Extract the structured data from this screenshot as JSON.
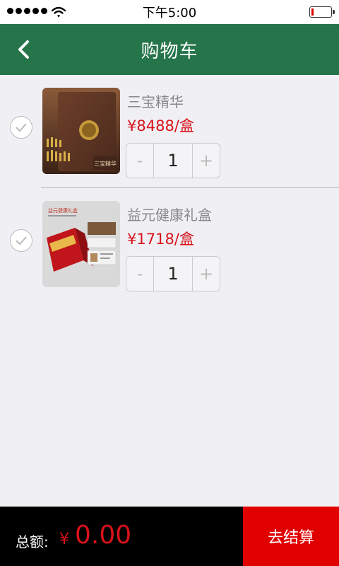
{
  "status_bar": {
    "time": "下午5:00"
  },
  "nav": {
    "title": "购物车",
    "back_icon": "chevron-left-icon"
  },
  "cart": {
    "items": [
      {
        "name": "三宝精华",
        "price": "¥8488/盒",
        "quantity": "1",
        "minus": "-",
        "plus": "+",
        "image_caption": "三宝精华"
      },
      {
        "name": "益元健康礼盒",
        "price": "¥1718/盒",
        "quantity": "1",
        "minus": "-",
        "plus": "+",
        "image_caption": "益元健康礼盒"
      }
    ]
  },
  "footer": {
    "total_label": "总额:",
    "currency": "¥",
    "total_amount": "0.00",
    "checkout_label": "去结算"
  },
  "colors": {
    "nav_green": "#26754a",
    "price_red": "#d8121a",
    "checkout_red": "#e00000"
  }
}
